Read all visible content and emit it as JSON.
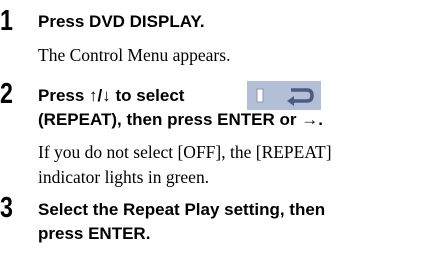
{
  "steps": [
    {
      "number": "1",
      "title": "Press DVD DISPLAY.",
      "body": "The Control Menu appears."
    },
    {
      "number": "2",
      "title_line1": "Press ↑/↓ to select",
      "title_line2": "(REPEAT), then press ENTER or →.",
      "body_line1": "If you do not select [OFF], the [REPEAT]",
      "body_line2": "indicator lights in green."
    },
    {
      "number": "3",
      "title_line1": "Select the Repeat Play setting, then",
      "title_line2": "press ENTER."
    }
  ],
  "icons": {
    "repeat": "repeat-icon"
  },
  "colors": {
    "text": "#000000",
    "icon_background": "#b3bfd6",
    "icon_arrow": "#4d5b83"
  }
}
